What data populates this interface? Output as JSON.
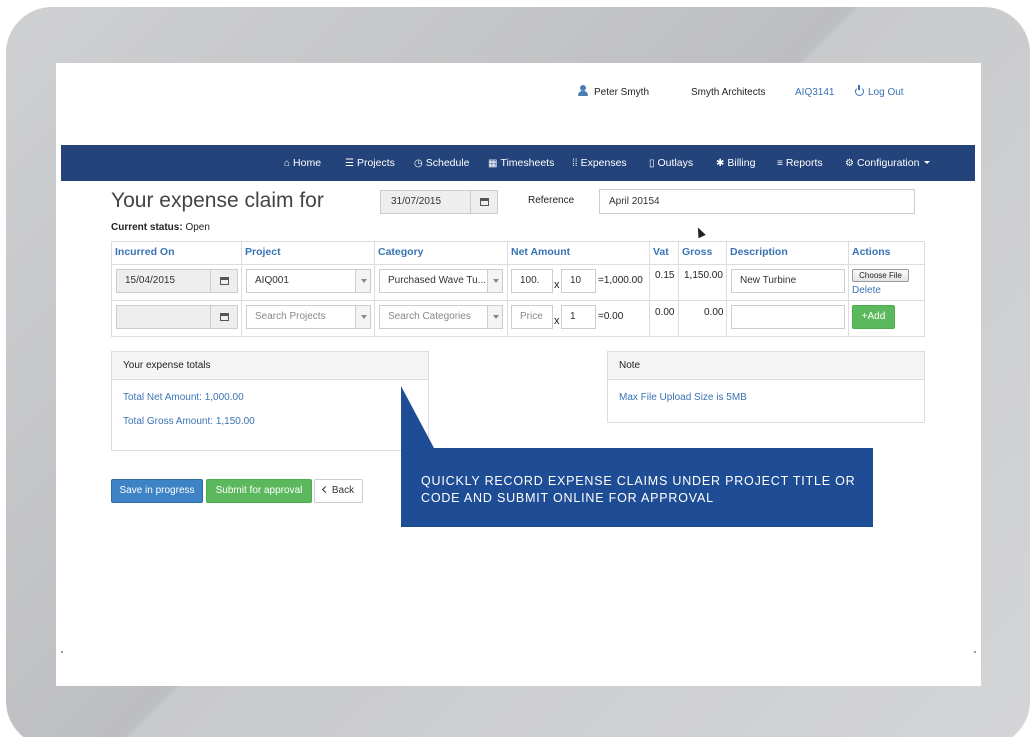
{
  "user": {
    "name": "Peter Smyth",
    "company": "Smyth Architects",
    "code": "AIQ3141",
    "logout_label": "Log Out"
  },
  "nav": {
    "items": [
      {
        "icon": "home-icon",
        "glyph": "⌂",
        "label": "Home"
      },
      {
        "icon": "projects-icon",
        "glyph": "☰",
        "label": "Projects"
      },
      {
        "icon": "clock-icon",
        "glyph": "◷",
        "label": "Schedule"
      },
      {
        "icon": "calendar-icon",
        "glyph": "▦",
        "label": "Timesheets"
      },
      {
        "icon": "grid-icon",
        "glyph": "⁞⁞",
        "label": "Expenses"
      },
      {
        "icon": "document-icon",
        "glyph": "▯",
        "label": "Outlays"
      },
      {
        "icon": "asterisk-icon",
        "glyph": "✱",
        "label": "Billing"
      },
      {
        "icon": "list-icon",
        "glyph": "≡",
        "label": "Reports"
      },
      {
        "icon": "cog-icon",
        "glyph": "⚙",
        "label": "Configuration"
      }
    ]
  },
  "claim": {
    "title": "Your expense claim for",
    "date": "31/07/2015",
    "reference_label": "Reference",
    "reference_value": "April 20154",
    "status_label": "Current status:",
    "status_value": "Open"
  },
  "table": {
    "headers": [
      "Incurred On",
      "Project",
      "Category",
      "Net Amount",
      "Vat",
      "Gross",
      "Description",
      "Actions"
    ],
    "row1": {
      "date": "15/04/2015",
      "project": "AIQ001",
      "category": "Purchased Wave Tu...",
      "price": "100.",
      "x": "x",
      "qty": "10",
      "net": "=1,000.00",
      "vat": "0.15",
      "gross": "1,150.00",
      "description": "New Turbine",
      "choose_file": "Choose File",
      "delete": "Delete"
    },
    "row2": {
      "date": "",
      "project_placeholder": "Search Projects",
      "category_placeholder": "Search Categories",
      "price_placeholder": "Price",
      "x": "x",
      "qty": "1",
      "net": "=0.00",
      "vat": "0.00",
      "gross": "0.00",
      "description": "",
      "add": "+Add"
    }
  },
  "totals": {
    "heading": "Your expense totals",
    "net": "Total Net Amount: 1,000.00",
    "gross": "Total Gross Amount: 1,150.00"
  },
  "note": {
    "heading": "Note",
    "text": "Max File Upload Size is 5MB"
  },
  "buttons": {
    "save": "Save in progress",
    "submit": "Submit for approval",
    "back": "Back"
  },
  "callout": {
    "text": "QUICKLY RECORD EXPENSE CLAIMS UNDER PROJECT TITLE OR CODE AND SUBMIT ONLINE FOR APPROVAL"
  },
  "colors": {
    "nav_bg": "#24437a",
    "link": "#3a73b4",
    "primary": "#3f83c7",
    "success": "#5cb85c",
    "callout_bg": "#1f4d95"
  }
}
